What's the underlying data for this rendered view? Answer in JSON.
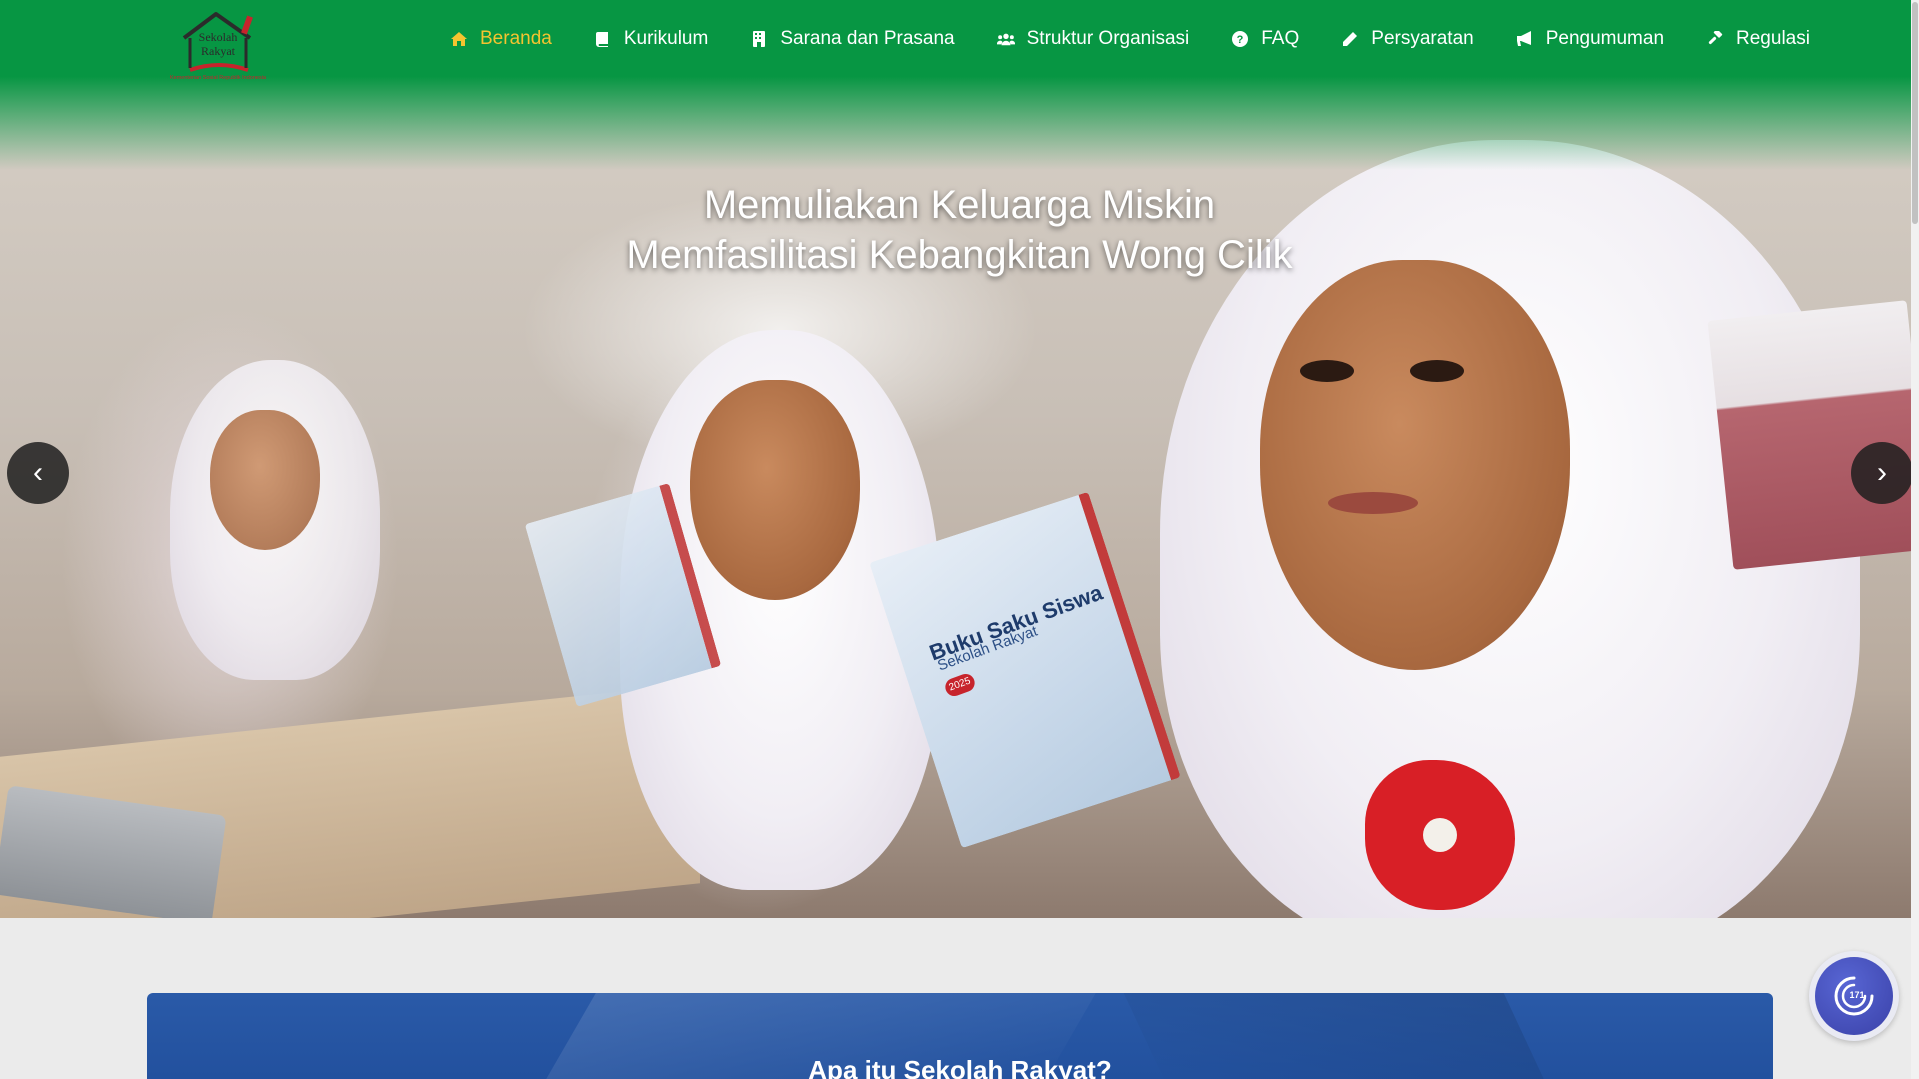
{
  "brand": {
    "logo_line1": "Sekolah",
    "logo_line2": "Rakyat",
    "tagline": "Kementerian Sosial Republik Indonesia"
  },
  "colors": {
    "nav_green": "#079643",
    "nav_active": "#f4c430",
    "card_blue": "#1f4d9a",
    "widget_blue": "#3a41a8"
  },
  "nav": {
    "items": [
      {
        "label": "Beranda",
        "icon": "home-icon",
        "active": true
      },
      {
        "label": "Kurikulum",
        "icon": "book-icon"
      },
      {
        "label": "Sarana dan Prasana",
        "icon": "building-icon"
      },
      {
        "label": "Struktur Organisasi",
        "icon": "users-icon"
      },
      {
        "label": "FAQ",
        "icon": "question-circle-icon"
      },
      {
        "label": "Persyaratan",
        "icon": "pencil-icon"
      },
      {
        "label": "Pengumuman",
        "icon": "megaphone-icon"
      },
      {
        "label": "Regulasi",
        "icon": "gavel-icon"
      }
    ]
  },
  "hero": {
    "title_line1": "Memuliakan Keluarga Miskin",
    "title_line2": "Memfasilitasi Kebangkitan Wong Cilik",
    "book_title": "Buku Saku Siswa",
    "book_subtitle": "Sekolah Rakyat",
    "book_year": "2025",
    "prev_label": "‹",
    "next_label": "›"
  },
  "about": {
    "title": "Apa itu Sekolah Rakyat?"
  },
  "widget": {
    "label": "171",
    "icon": "accessibility-icon"
  }
}
